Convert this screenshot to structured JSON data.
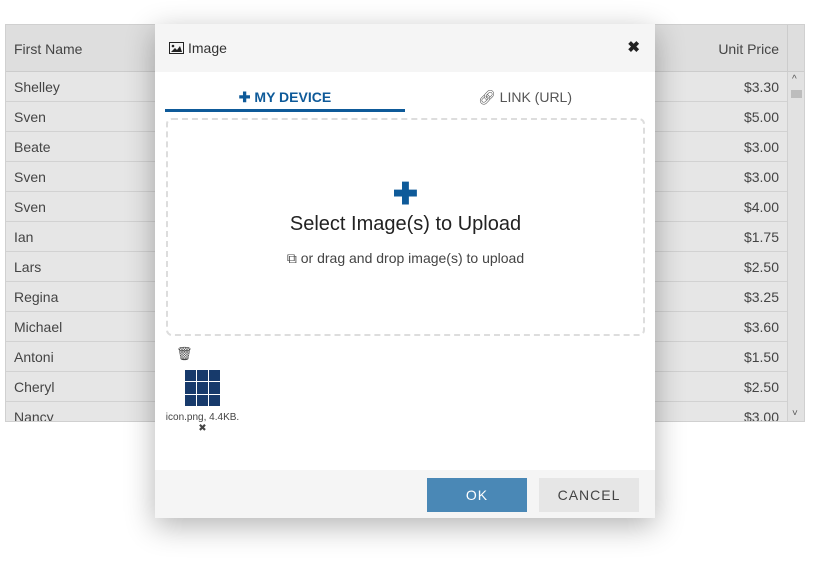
{
  "grid": {
    "headers": [
      "First Name",
      "Unit Price"
    ],
    "rows": [
      [
        "Shelley",
        "$3.30"
      ],
      [
        "Sven",
        "$5.00"
      ],
      [
        "Beate",
        "$3.00"
      ],
      [
        "Sven",
        "$3.00"
      ],
      [
        "Sven",
        "$4.00"
      ],
      [
        "Ian",
        "$1.75"
      ],
      [
        "Lars",
        "$2.50"
      ],
      [
        "Regina",
        "$3.25"
      ],
      [
        "Michael",
        "$3.60"
      ],
      [
        "Antoni",
        "$1.50"
      ],
      [
        "Cheryl",
        "$2.50"
      ],
      [
        "Nancy",
        "$3.00"
      ]
    ]
  },
  "dialog": {
    "title": "Image",
    "tabs": [
      {
        "label": "MY DEVICE",
        "icon": "plus-icon",
        "active": true
      },
      {
        "label": "LINK (URL)",
        "icon": "link-icon",
        "active": false
      }
    ],
    "drop": {
      "title": "Select Image(s) to Upload",
      "hint": "or drag and drop image(s) to upload"
    },
    "file": {
      "caption": "icon.png, 4.4KB."
    },
    "ok": "OK",
    "cancel": "CANCEL"
  },
  "colors": {
    "accent": "#0e5a99",
    "ok_button": "#4a88b6"
  }
}
